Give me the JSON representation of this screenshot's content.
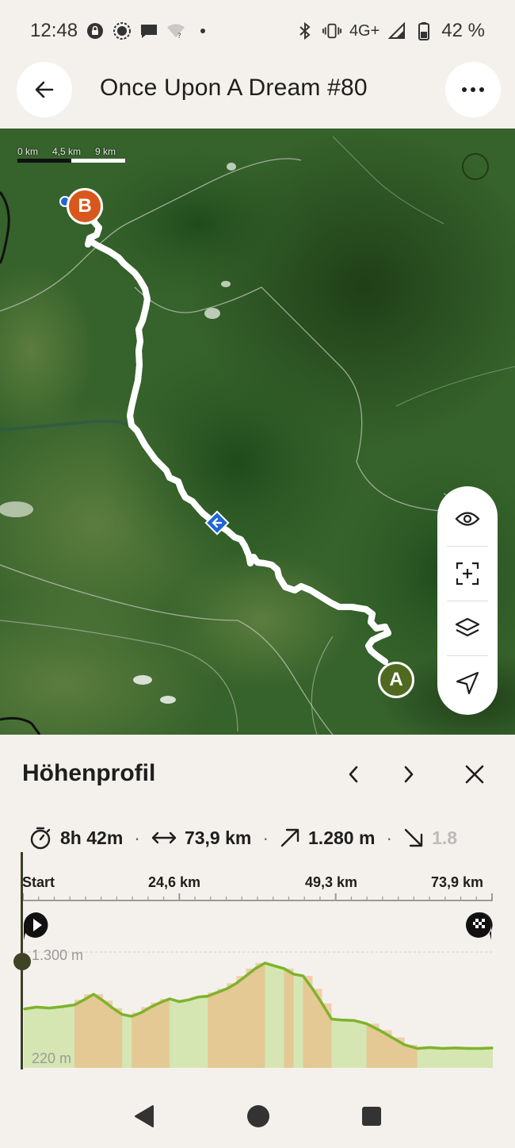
{
  "status_bar": {
    "time": "12:48",
    "network": "4G+",
    "battery": "42 %"
  },
  "header": {
    "title": "Once Upon A Dream #80",
    "back_icon": "arrow-left-icon",
    "more_icon": "more-horizontal-icon"
  },
  "map": {
    "scale_labels": [
      "0 km",
      "4,5 km",
      "9 km"
    ],
    "marker_start": "A",
    "marker_end": "B",
    "tools": [
      "eye-icon",
      "crosshair-frame-icon",
      "layers-icon",
      "navigate-icon"
    ],
    "colors": {
      "route": "#1f66d6",
      "marker_a": "#4f6a20",
      "marker_b": "#d8571c"
    }
  },
  "elevation": {
    "title": "Höhenprofil",
    "stats": {
      "duration": "8h 42m",
      "distance": "73,9 km",
      "ascent": "1.280 m",
      "descent": "1.8"
    },
    "axis_labels": [
      "Start",
      "24,6 km",
      "49,3 km",
      "73,9 km"
    ],
    "y_top_label": "1.300 m",
    "y_bottom_label": "220 m"
  },
  "chart_data": {
    "type": "area",
    "xlabel": "",
    "ylabel": "",
    "xlim": [
      0,
      73.9
    ],
    "ylim": [
      220,
      1300
    ],
    "x": [
      0,
      2,
      4,
      6,
      8,
      9.5,
      11,
      12.5,
      14,
      15.5,
      17,
      18.5,
      20,
      21.5,
      23,
      24.5,
      26,
      27.5,
      29,
      30.5,
      32,
      33.5,
      35,
      36.5,
      38,
      39.5,
      41,
      42.5,
      44,
      45.5,
      47,
      48.5,
      50,
      52,
      54,
      56,
      58,
      60,
      62,
      64,
      66,
      68,
      70,
      72,
      73.9
    ],
    "y": [
      680,
      700,
      690,
      705,
      725,
      780,
      840,
      770,
      690,
      620,
      600,
      640,
      700,
      750,
      790,
      760,
      780,
      810,
      820,
      860,
      900,
      960,
      1040,
      1120,
      1180,
      1150,
      1120,
      1060,
      1040,
      900,
      740,
      570,
      560,
      555,
      520,
      450,
      370,
      290,
      250,
      260,
      250,
      255,
      250,
      250,
      255
    ],
    "colors": {
      "line": "#7fb32a",
      "fill": "#d5e6b3",
      "steep": "#f0b07a"
    }
  },
  "navbar": [
    "back-triangle-icon",
    "home-circle-icon",
    "recents-square-icon"
  ]
}
